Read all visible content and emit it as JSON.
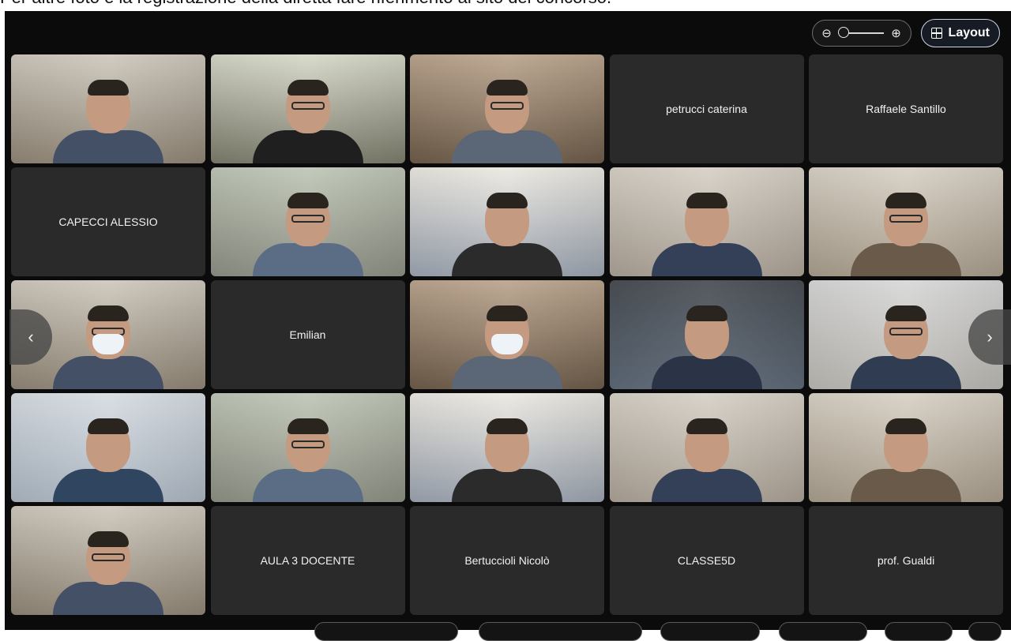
{
  "caption": "Per altre foto e la registrazione della diretta fare riferimento al sito del concorso.",
  "toolbar": {
    "zoom_out_icon": "zoom-out-icon",
    "zoom_in_icon": "zoom-in-icon",
    "zoom_level": 0,
    "layout_label": "Layout",
    "layout_icon": "grid-layout-icon"
  },
  "grid": {
    "tiles": [
      {
        "type": "video"
      },
      {
        "type": "video"
      },
      {
        "type": "video"
      },
      {
        "type": "name",
        "label": "petrucci caterina"
      },
      {
        "type": "name",
        "label": "Raffaele Santillo"
      },
      {
        "type": "name",
        "label": "CAPECCI ALESSIO"
      },
      {
        "type": "video"
      },
      {
        "type": "video"
      },
      {
        "type": "video"
      },
      {
        "type": "video"
      },
      {
        "type": "video"
      },
      {
        "type": "name",
        "label": "Emilian"
      },
      {
        "type": "video"
      },
      {
        "type": "video"
      },
      {
        "type": "video"
      },
      {
        "type": "video"
      },
      {
        "type": "video"
      },
      {
        "type": "video"
      },
      {
        "type": "video"
      },
      {
        "type": "video"
      },
      {
        "type": "video"
      },
      {
        "type": "name",
        "label": "AULA 3 DOCENTE"
      },
      {
        "type": "name",
        "label": "Bertuccioli Nicolò"
      },
      {
        "type": "name",
        "label": "CLASSE5D"
      },
      {
        "type": "name",
        "label": "prof. Gualdi"
      }
    ]
  },
  "nav": {
    "prev_icon": "chevron-left-icon",
    "next_icon": "chevron-right-icon"
  }
}
